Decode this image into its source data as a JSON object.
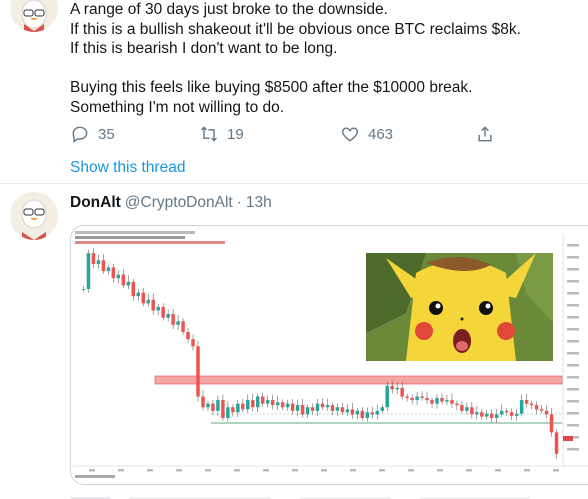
{
  "tweet1": {
    "text": "A range of 30 days just broke to the downside.\nIf this is a bullish shakeout it'll be obvious once BTC reclaims $8k.\nIf this is bearish I don't want to be long.\n\nBuying this feels like buying $8500 after the $10000 break.\nSomething I'm not willing to do.",
    "replies": "35",
    "retweets": "19",
    "likes": "463",
    "show_thread": "Show this thread"
  },
  "tweet2": {
    "name": "DonAlt",
    "handle": "@CryptoDonAlt",
    "separator": "·",
    "time": "13h"
  },
  "chart_data": {
    "type": "candlestick",
    "series": [
      {
        "values": [
          9800,
          10300,
          10150,
          10200,
          10050,
          10100,
          9950,
          10000,
          9850,
          9900,
          9700,
          9750,
          9600,
          9650,
          9500,
          9550,
          9400,
          9450,
          9300,
          9350,
          9200,
          9100,
          9000,
          8300,
          8150,
          8200,
          8100,
          8250,
          8000,
          8150,
          8080,
          8200,
          8120,
          8250,
          8150,
          8300,
          8200,
          8250,
          8180,
          8220,
          8150,
          8200,
          8100,
          8180,
          8050,
          8150,
          8100,
          8200,
          8150,
          8180,
          8100,
          8150,
          8080,
          8120,
          8050,
          8100,
          8000,
          8080,
          8050,
          8100,
          8150,
          8450,
          8400,
          8420,
          8300,
          8280,
          8250,
          8300,
          8280,
          8250,
          8200,
          8280,
          8230,
          8250,
          8200,
          8180,
          8100,
          8150,
          8050,
          8080,
          8020,
          8060,
          8000,
          8050,
          8100,
          8080,
          8030,
          8060,
          8250,
          8200,
          8180,
          8120,
          8100,
          8050,
          7800,
          7500
        ]
      }
    ],
    "annotations": {
      "resistance_zone": [
        8200,
        8300
      ],
      "support_line": 8000
    },
    "grid": false
  }
}
